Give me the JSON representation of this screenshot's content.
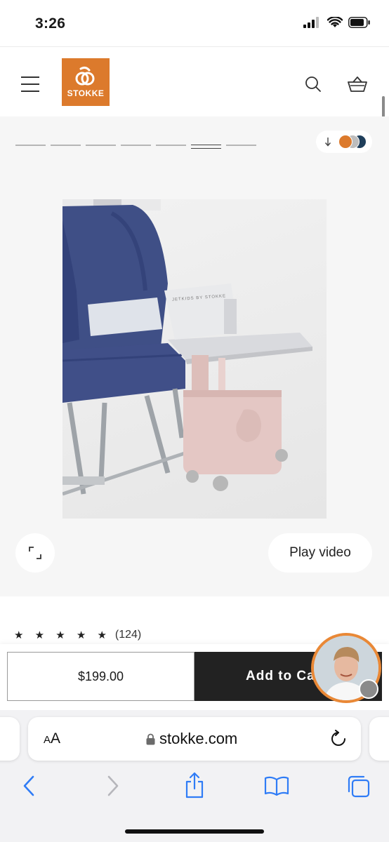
{
  "status_bar": {
    "time": "3:26",
    "icons": [
      "cellular-signal-icon",
      "wifi-icon",
      "battery-icon"
    ]
  },
  "header": {
    "logo_text": "STOKKE",
    "brand_color": "#dc7a2c",
    "icons": [
      "hamburger-menu-icon",
      "search-icon",
      "basket-icon"
    ]
  },
  "gallery": {
    "dot_count": 7,
    "active_dot": 6,
    "color_swatches": [
      "#dc7a2c",
      "#bdbdbd",
      "#1f3e5a"
    ],
    "image_alt": "JetKids BedBox ride-on suitcase attached to airplane seat",
    "bedbox_print": "JETKIDS BY STOKKE",
    "play_video_label": "Play video"
  },
  "rating": {
    "stars": "★ ★ ★ ★ ★",
    "value": 4.5,
    "count": "(124)"
  },
  "buy_bar": {
    "price": "$199.00",
    "add_to_cart_label": "Add to Cart"
  },
  "safari": {
    "aa_label_small": "A",
    "aa_label_big": "A",
    "domain": "stokke.com",
    "icons": [
      "back-icon",
      "forward-icon",
      "share-icon",
      "bookmarks-icon",
      "tabs-icon"
    ]
  }
}
